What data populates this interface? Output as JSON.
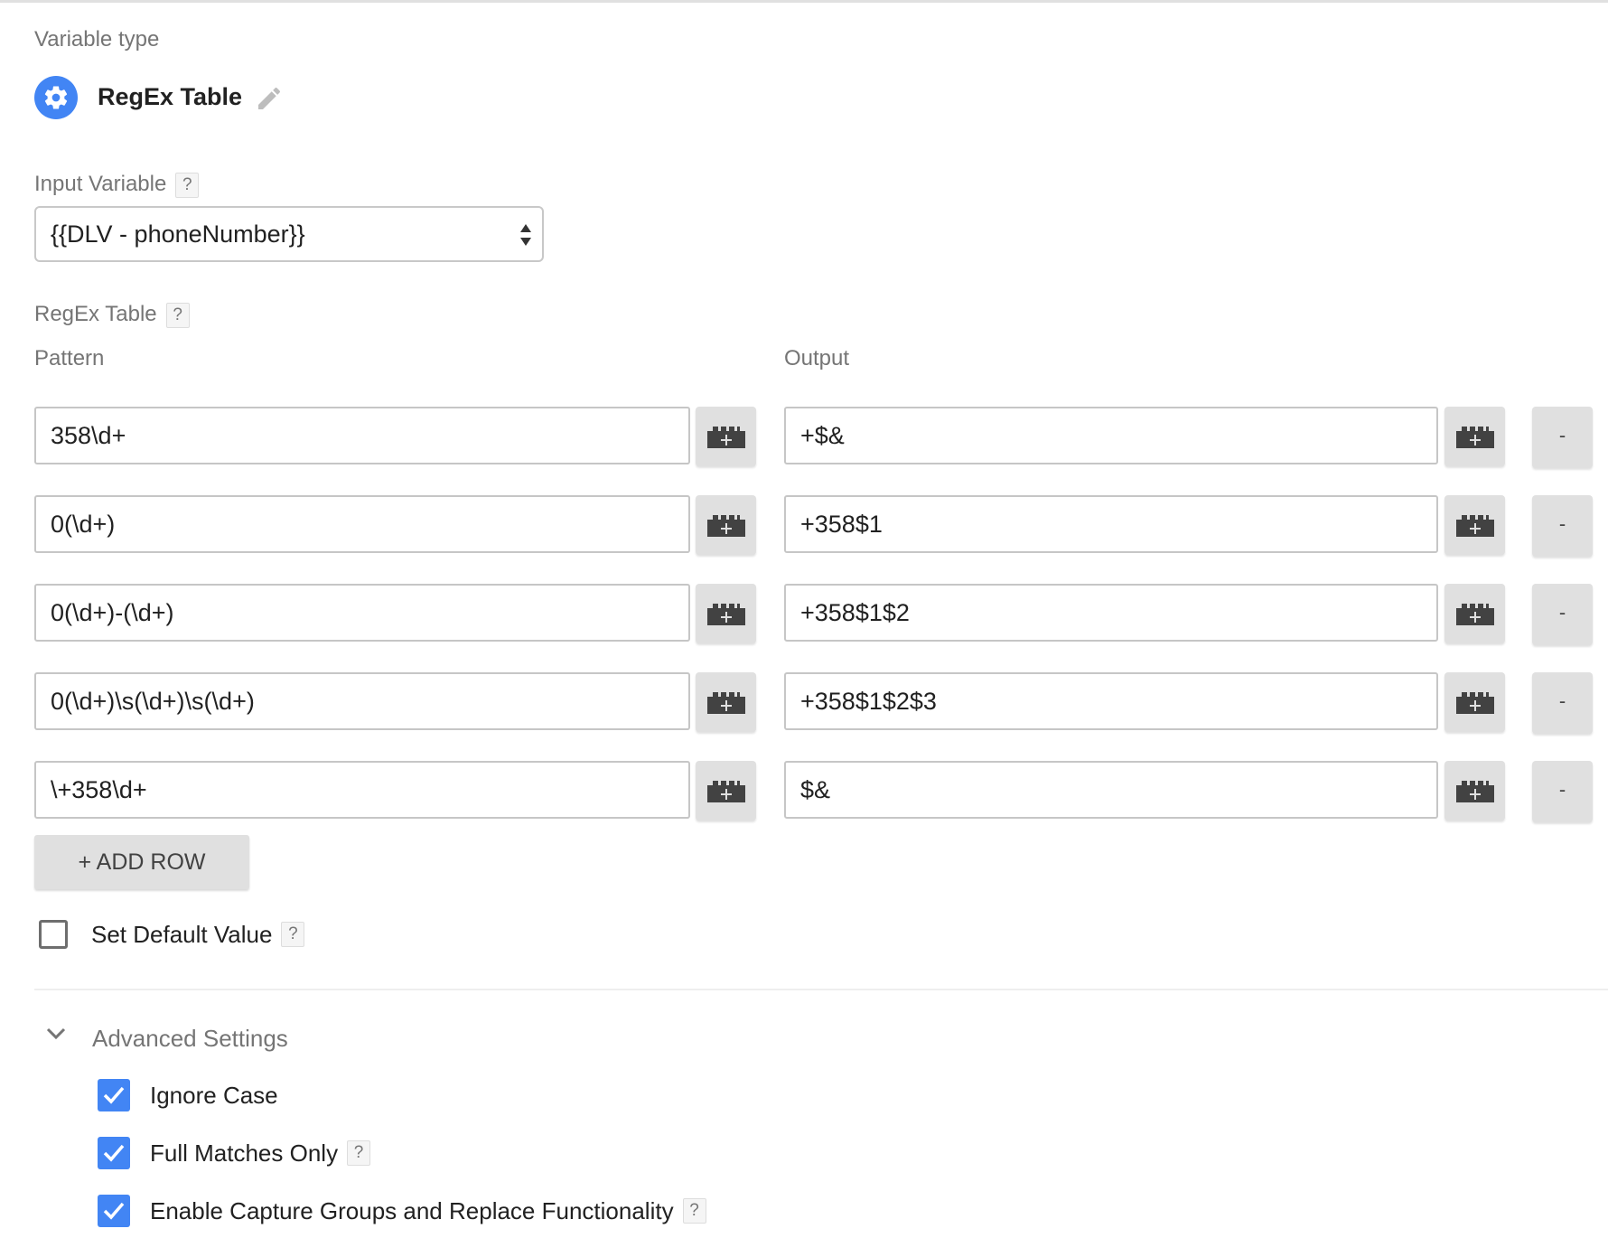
{
  "variable_type": {
    "label": "Variable type",
    "name": "RegEx Table",
    "icon": "gear-icon",
    "edit_icon": "pencil-icon"
  },
  "input_variable": {
    "label": "Input Variable",
    "help": "?",
    "value": "{{DLV - phoneNumber}}"
  },
  "regex_table": {
    "label": "RegEx Table",
    "help": "?",
    "pattern_header": "Pattern",
    "output_header": "Output",
    "rows": [
      {
        "pattern": "358\\d+",
        "output": "+$&"
      },
      {
        "pattern": "0(\\d+)",
        "output": "+358$1"
      },
      {
        "pattern": "0(\\d+)-(\\d+)",
        "output": "+358$1$2"
      },
      {
        "pattern": "0(\\d+)\\s(\\d+)\\s(\\d+)",
        "output": "+358$1$2$3"
      },
      {
        "pattern": "\\+358\\d+",
        "output": "$&"
      }
    ],
    "remove_label": "-",
    "variable_picker_icon": "add-variable-brick-icon",
    "add_row_label": "+ ADD ROW"
  },
  "default_value": {
    "label": "Set Default Value",
    "help": "?",
    "checked": false
  },
  "advanced": {
    "label": "Advanced Settings",
    "expanded": true,
    "options": [
      {
        "label": "Ignore Case",
        "checked": true,
        "help": ""
      },
      {
        "label": "Full Matches Only",
        "checked": true,
        "help": "?"
      },
      {
        "label": "Enable Capture Groups and Replace Functionality",
        "checked": true,
        "help": "?"
      }
    ]
  },
  "colors": {
    "accent": "#4285f4",
    "button_bg": "#e0e0e0",
    "label": "#757575"
  }
}
